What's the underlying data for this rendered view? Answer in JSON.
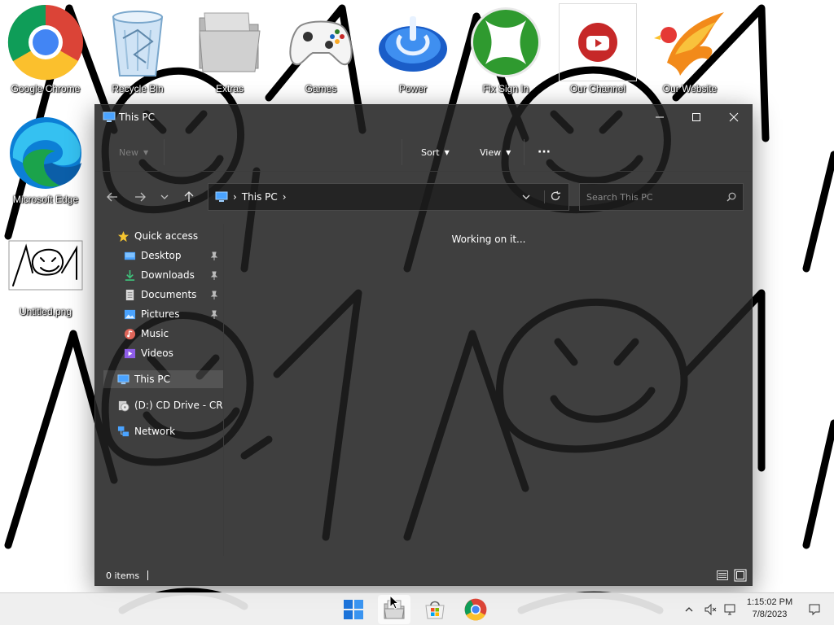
{
  "desktop": {
    "icons": [
      {
        "label": "Google Chrome",
        "icon": "chrome-icon"
      },
      {
        "label": "Recycle Bin",
        "icon": "recycle-bin-icon"
      },
      {
        "label": "Extras",
        "icon": "folder-icon"
      },
      {
        "label": "Games",
        "icon": "gamepad-icon"
      },
      {
        "label": "Power",
        "icon": "power-icon"
      },
      {
        "label": "Fix Sign In",
        "icon": "xbox-icon"
      },
      {
        "label": "Our Channel",
        "icon": "youtube-icon"
      },
      {
        "label": "Our Website",
        "icon": "phoenix-icon"
      },
      {
        "label": "Microsoft Edge",
        "icon": "edge-icon"
      },
      {
        "label": "Untitled.png",
        "icon": "image-file-icon"
      }
    ]
  },
  "window": {
    "title": "This PC",
    "toolbar": {
      "new_label": "New",
      "sort_label": "Sort",
      "view_label": "View",
      "more_label": "···"
    },
    "address": {
      "crumb": "This PC",
      "separator": "›"
    },
    "search": {
      "placeholder": "Search This PC"
    },
    "nav": {
      "quick_access": "Quick access",
      "desktop": "Desktop",
      "downloads": "Downloads",
      "documents": "Documents",
      "pictures": "Pictures",
      "music": "Music",
      "videos": "Videos",
      "this_pc": "This PC",
      "cd_drive": "(D:) CD Drive - CRM",
      "network": "Network"
    },
    "content": {
      "status_message": "Working on it..."
    },
    "statusbar": {
      "item_count": "0 items"
    }
  },
  "taskbar": {
    "apps": [
      "start-icon",
      "file-explorer-icon",
      "microsoft-store-icon",
      "chrome-icon"
    ],
    "clock": {
      "time": "1:15:02 PM",
      "date": "7/8/2023"
    }
  },
  "colors": {
    "window_bg": "#202020",
    "accent_blue": "#4aa3ff",
    "star_yellow": "#f4c430"
  }
}
